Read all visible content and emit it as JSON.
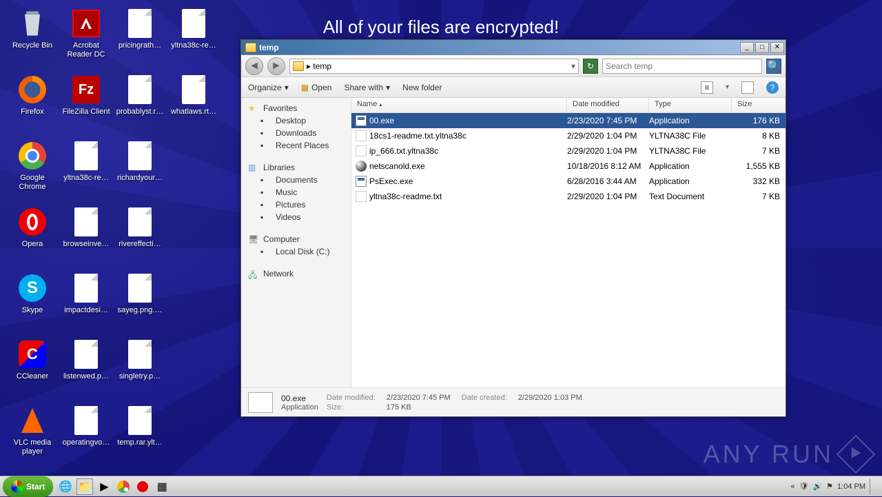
{
  "ransom_message": "All of your files are encrypted!",
  "desktop_icons": [
    {
      "icon": "recycle",
      "label": "Recycle Bin"
    },
    {
      "icon": "adobe",
      "label": "Acrobat Reader DC"
    },
    {
      "icon": "file",
      "label": "pricingrath…"
    },
    {
      "icon": "file",
      "label": "yltna38c-re…"
    },
    {
      "icon": "firefox",
      "label": "Firefox"
    },
    {
      "icon": "filezilla",
      "label": "FileZilla Client"
    },
    {
      "icon": "file",
      "label": "probablyst.r…"
    },
    {
      "icon": "file",
      "label": "whatlaws.rt…"
    },
    {
      "icon": "chrome",
      "label": "Google Chrome"
    },
    {
      "icon": "file",
      "label": "yltna38c-re…"
    },
    {
      "icon": "file",
      "label": "richardyour…"
    },
    {
      "icon": "",
      "label": ""
    },
    {
      "icon": "opera",
      "label": "Opera"
    },
    {
      "icon": "file",
      "label": "browseinve…"
    },
    {
      "icon": "file",
      "label": "rivereffecti…"
    },
    {
      "icon": "",
      "label": ""
    },
    {
      "icon": "skype",
      "label": "Skype"
    },
    {
      "icon": "file",
      "label": "impactdesi…"
    },
    {
      "icon": "file",
      "label": "sayeg.png.…"
    },
    {
      "icon": "",
      "label": ""
    },
    {
      "icon": "ccleaner",
      "label": "CCleaner"
    },
    {
      "icon": "file",
      "label": "listenwed.p…"
    },
    {
      "icon": "file",
      "label": "singletry.p…"
    },
    {
      "icon": "",
      "label": ""
    },
    {
      "icon": "vlc",
      "label": "VLC media player"
    },
    {
      "icon": "file",
      "label": "operatingvo…"
    },
    {
      "icon": "file",
      "label": "temp.rar.ylt…"
    }
  ],
  "explorer": {
    "title": "temp",
    "path_prefix": "▸",
    "path": "temp",
    "search_placeholder": "Search temp",
    "toolbar": {
      "organize": "Organize",
      "open": "Open",
      "share": "Share with",
      "newfolder": "New folder"
    },
    "sidebar": {
      "favorites": "Favorites",
      "favorites_items": [
        "Desktop",
        "Downloads",
        "Recent Places"
      ],
      "libraries": "Libraries",
      "libraries_items": [
        "Documents",
        "Music",
        "Pictures",
        "Videos"
      ],
      "computer": "Computer",
      "computer_items": [
        "Local Disk (C:)"
      ],
      "network": "Network"
    },
    "columns": {
      "name": "Name",
      "date": "Date modified",
      "type": "Type",
      "size": "Size"
    },
    "files": [
      {
        "sel": true,
        "icon": "exe",
        "name": "00.exe",
        "date": "2/23/2020 7:45 PM",
        "type": "Application",
        "size": "176 KB"
      },
      {
        "sel": false,
        "icon": "txt",
        "name": "18cs1-readme.txt.yltna38c",
        "date": "2/29/2020 1:04 PM",
        "type": "YLTNA38C File",
        "size": "8 KB"
      },
      {
        "sel": false,
        "icon": "txt",
        "name": "ip_666.txt.yltna38c",
        "date": "2/29/2020 1:04 PM",
        "type": "YLTNA38C File",
        "size": "7 KB"
      },
      {
        "sel": false,
        "icon": "ball",
        "name": "netscanold.exe",
        "date": "10/18/2016 8:12 AM",
        "type": "Application",
        "size": "1,555 KB"
      },
      {
        "sel": false,
        "icon": "exe",
        "name": "PsExec.exe",
        "date": "6/28/2016 3:44 AM",
        "type": "Application",
        "size": "332 KB"
      },
      {
        "sel": false,
        "icon": "txt",
        "name": "yltna38c-readme.txt",
        "date": "2/29/2020 1:04 PM",
        "type": "Text Document",
        "size": "7 KB"
      }
    ],
    "details": {
      "name": "00.exe",
      "type": "Application",
      "dm_label": "Date modified:",
      "dm": "2/23/2020 7:45 PM",
      "dc_label": "Date created:",
      "dc": "2/29/2020 1:03 PM",
      "size_label": "Size:",
      "size": "175 KB"
    }
  },
  "taskbar": {
    "start": "Start",
    "time": "1:04 PM"
  },
  "watermark": "ANY    RUN"
}
